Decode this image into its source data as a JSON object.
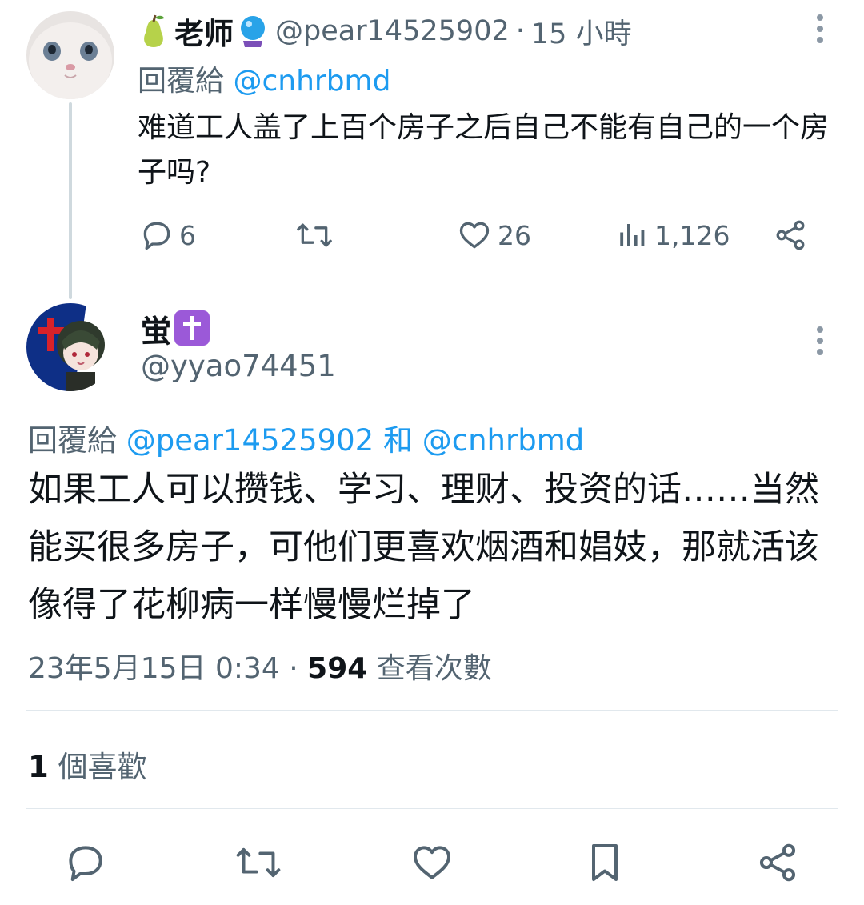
{
  "parent": {
    "name": "老师",
    "handle": "@pear14525902",
    "separator": "·",
    "time": "15 小時",
    "reply_to_label": "回覆給",
    "reply_to_handle": "@cnhrbmd",
    "text": "难道工人盖了上百个房子之后自己不能有自己的一个房子吗?",
    "stats": {
      "replies": "6",
      "likes": "26",
      "views": "1,126"
    },
    "icons": [
      "pear-emoji-icon",
      "crystal-ball-emoji-icon"
    ]
  },
  "main": {
    "name": "蛍",
    "name_badge_icon": "latin-cross-emoji-icon",
    "handle": "@yyao74451",
    "reply_to_label": "回覆給",
    "reply_to_handle_1": "@pear14525902",
    "reply_to_conj": "和",
    "reply_to_handle_2": "@cnhrbmd",
    "text": "如果工人可以攒钱、学习、理财、投资的话……当然能买很多房子，可他们更喜欢烟酒和娼妓，那就活该像得了花柳病一样慢慢烂掉了",
    "date": "23年5月15日 0:34",
    "separator": "·",
    "view_count": "594",
    "view_label": "查看次數",
    "like_count": "1",
    "like_label": "個喜歡"
  },
  "colors": {
    "link": "#1d9bf0",
    "secondary_text": "#536471",
    "primary_text": "#0f1419",
    "thread_line": "#cfd9de"
  }
}
